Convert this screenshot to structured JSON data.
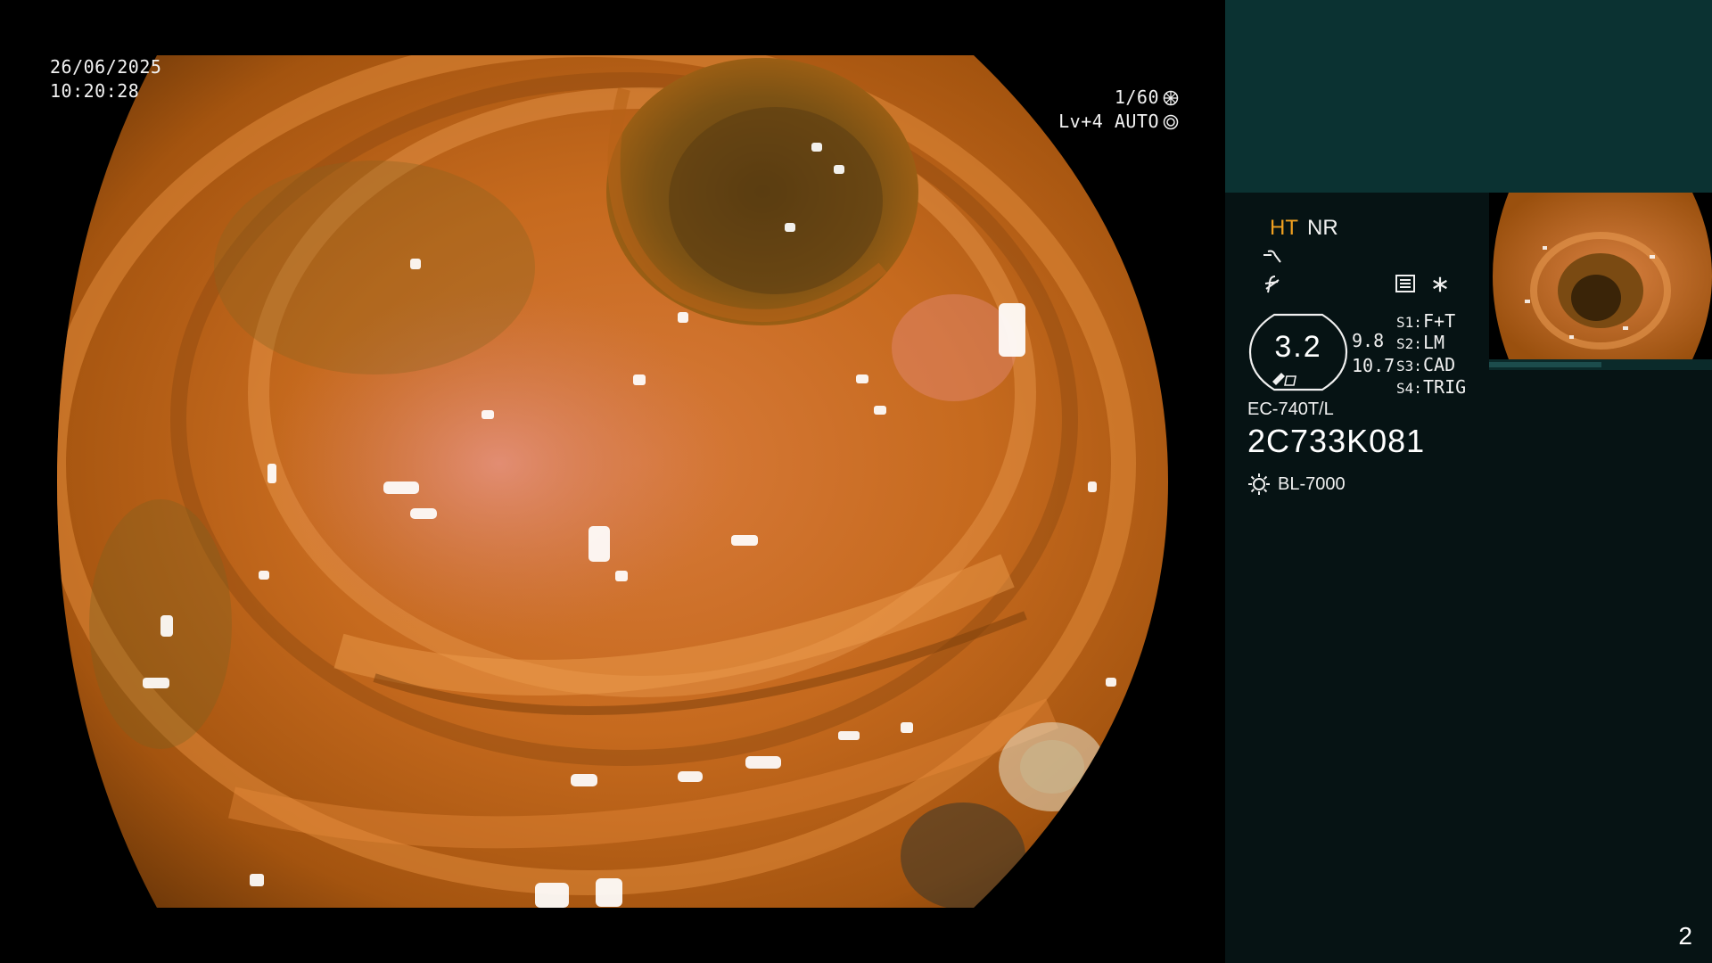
{
  "overlay": {
    "date": "26/06/2025",
    "time": "10:20:28",
    "shutter": "1/60",
    "level": "Lv+4 AUTO"
  },
  "panel": {
    "mode_ht": "HT",
    "mode_nr": "NR",
    "enhancement_value": "3.2",
    "stack_top": "9.8",
    "stack_bottom": "10.7",
    "switches": [
      {
        "key": "S1:",
        "value": "F+T"
      },
      {
        "key": "S2:",
        "value": "LM"
      },
      {
        "key": "S3:",
        "value": "CAD"
      },
      {
        "key": "S4:",
        "value": "TRIG"
      }
    ],
    "scope_model": "EC-740T/L",
    "serial": "2C733K081",
    "light_source": "BL-7000",
    "page_number": "2"
  },
  "icons": [
    "shutter-icon",
    "auto-iris-icon",
    "curve-symbol-icon",
    "f-symbol-icon",
    "menu-list-icon",
    "asterisk-icon",
    "scope-tip-icon",
    "light-bulb-icon"
  ],
  "colors": {
    "accent_ht": "#f0a020",
    "panel_bg": "#061314",
    "panel_top": "#0b3232"
  }
}
